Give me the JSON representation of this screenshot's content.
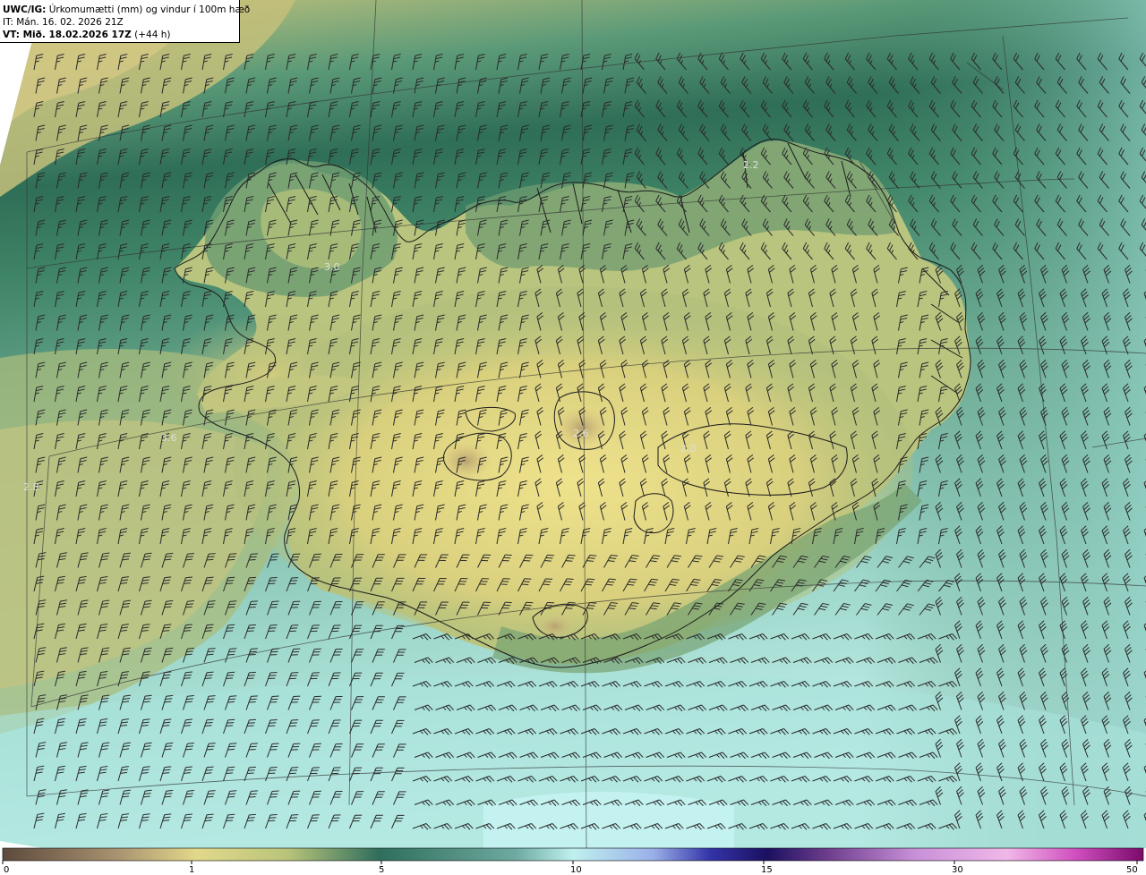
{
  "header": {
    "line1_bold": "UWC/IG:",
    "line1_rest": " Úrkomumætti (mm) og vindur í 100m hæð",
    "line2": "IT: Mán. 16. 02. 2026 21Z",
    "line3_bold": "VT: Mið. 18.02.2026 17Z",
    "line3_rest": " (+44 h)"
  },
  "contour_labels": [
    {
      "text": "3.0",
      "pos": [
        362,
        302
      ]
    },
    {
      "text": "3.6",
      "pos": [
        180,
        493
      ]
    },
    {
      "text": "2.8",
      "pos": [
        26,
        548
      ]
    },
    {
      "text": "2.0",
      "pos": [
        760,
        505
      ]
    },
    {
      "text": "2.6",
      "pos": [
        640,
        488
      ]
    },
    {
      "text": "2.2",
      "pos": [
        830,
        188
      ]
    }
  ],
  "colorbar": {
    "ticks": [
      "0",
      "1",
      "5",
      "10",
      "15",
      "30",
      "50"
    ],
    "colors": [
      "#5d4a3c",
      "#a89270",
      "#e2d88a",
      "#b8c47a",
      "#6e9a6a",
      "#2f6e5c",
      "#7cb8ae",
      "#bff0ef",
      "#9ab0e8",
      "#2a2a9a",
      "#1a1060",
      "#7a3a8a",
      "#e8a8e0",
      "#c040b0",
      "#7a0a6a"
    ]
  },
  "colors": {
    "land_yellow": "#ece08c",
    "land_green": "#8fae72",
    "sea_teal": "#7fbdb2",
    "sea_light": "#b8ece6",
    "dark_band": "#2f6a55",
    "outside": "#ffffff"
  }
}
